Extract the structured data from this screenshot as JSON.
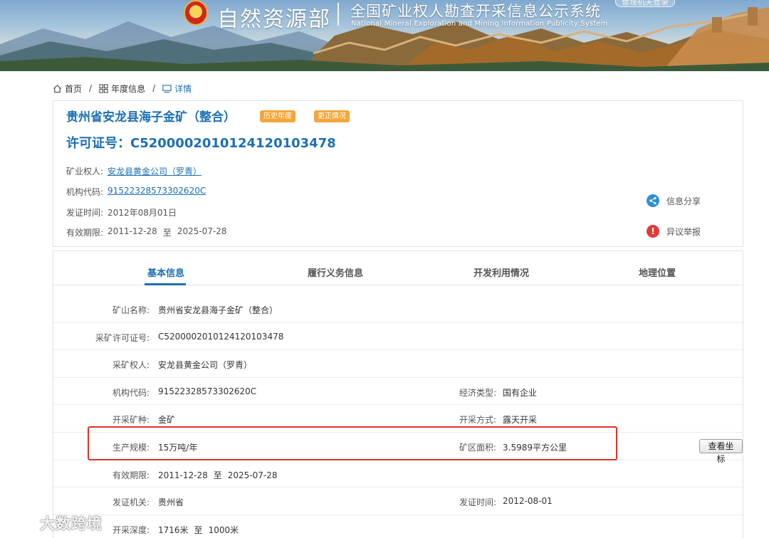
{
  "header": {
    "site_name": "自然资源部",
    "subtitle": "全国矿业权人勘查开采信息公示系统",
    "subtitle_en": "National Mineral Exploration and Mining Information Publicity System",
    "login_label": "管理机关登录"
  },
  "breadcrumb": [
    {
      "label": "首页",
      "icon": "home-icon"
    },
    {
      "label": "年度信息",
      "icon": "grid-icon"
    },
    {
      "label": "详情",
      "icon": "monitor-icon"
    }
  ],
  "summary": {
    "title": "贵州省安龙县海子金矿（整合）",
    "tag_history": "历史年度",
    "tag_correction": "更正情况",
    "license": "许可证号：C5200002010124120103478",
    "owner_label": "矿业权人:",
    "owner_value": "安龙县黄金公司（罗青）",
    "org_code_label": "机构代码:",
    "org_code_value": "91522328573302620C",
    "issue_date_label": "发证时间:",
    "issue_date_value": "2012年08月01日",
    "validity_label": "有效期限:",
    "validity_start": "2011-12-28",
    "validity_to": "至",
    "validity_end": "2025-07-28",
    "share_label": "信息分享",
    "report_label": "异议举报"
  },
  "tabs": [
    {
      "label": "基本信息",
      "active": true
    },
    {
      "label": "履行义务信息",
      "active": false
    },
    {
      "label": "开发利用情况",
      "active": false
    },
    {
      "label": "地理位置",
      "active": false
    }
  ],
  "details": {
    "mine_name_label": "矿山名称:",
    "mine_name_value": "贵州省安龙县海子金矿（整合）",
    "license_label": "采矿许可证号:",
    "license_value": "C5200002010124120103478",
    "owner_label": "采矿权人:",
    "owner_value": "安龙县黄金公司（罗青）",
    "org_code_label": "机构代码:",
    "org_code_value": "91522328573302620C",
    "econ_type_label": "经济类型:",
    "econ_type_value": "国有企业",
    "mineral_label": "开采矿种:",
    "mineral_value": "金矿",
    "method_label": "开采方式:",
    "method_value": "露天开采",
    "scale_label": "生产规模:",
    "scale_value": "15万吨/年",
    "area_label": "矿区面积:",
    "area_value": "3.5989平方公里",
    "coord_button": "查看坐标",
    "validity_label": "有效期限:",
    "validity_start": "2011-12-28",
    "validity_to": "至",
    "validity_end": "2025-07-28",
    "authority_label": "发证机关:",
    "authority_value": "贵州省",
    "issue_date_label": "发证时间:",
    "issue_date_value": "2012-08-01",
    "depth_label": "开采深度:",
    "depth_from": "1716米",
    "depth_to": "至",
    "depth_end": "1000米"
  },
  "watermark": {
    "text": "大数跨境"
  },
  "colors": {
    "accent": "#1c6fb4",
    "tag": "#f3a63a",
    "highlight": "#d9342b",
    "share": "#2f8fd8",
    "report": "#e23a3a"
  }
}
